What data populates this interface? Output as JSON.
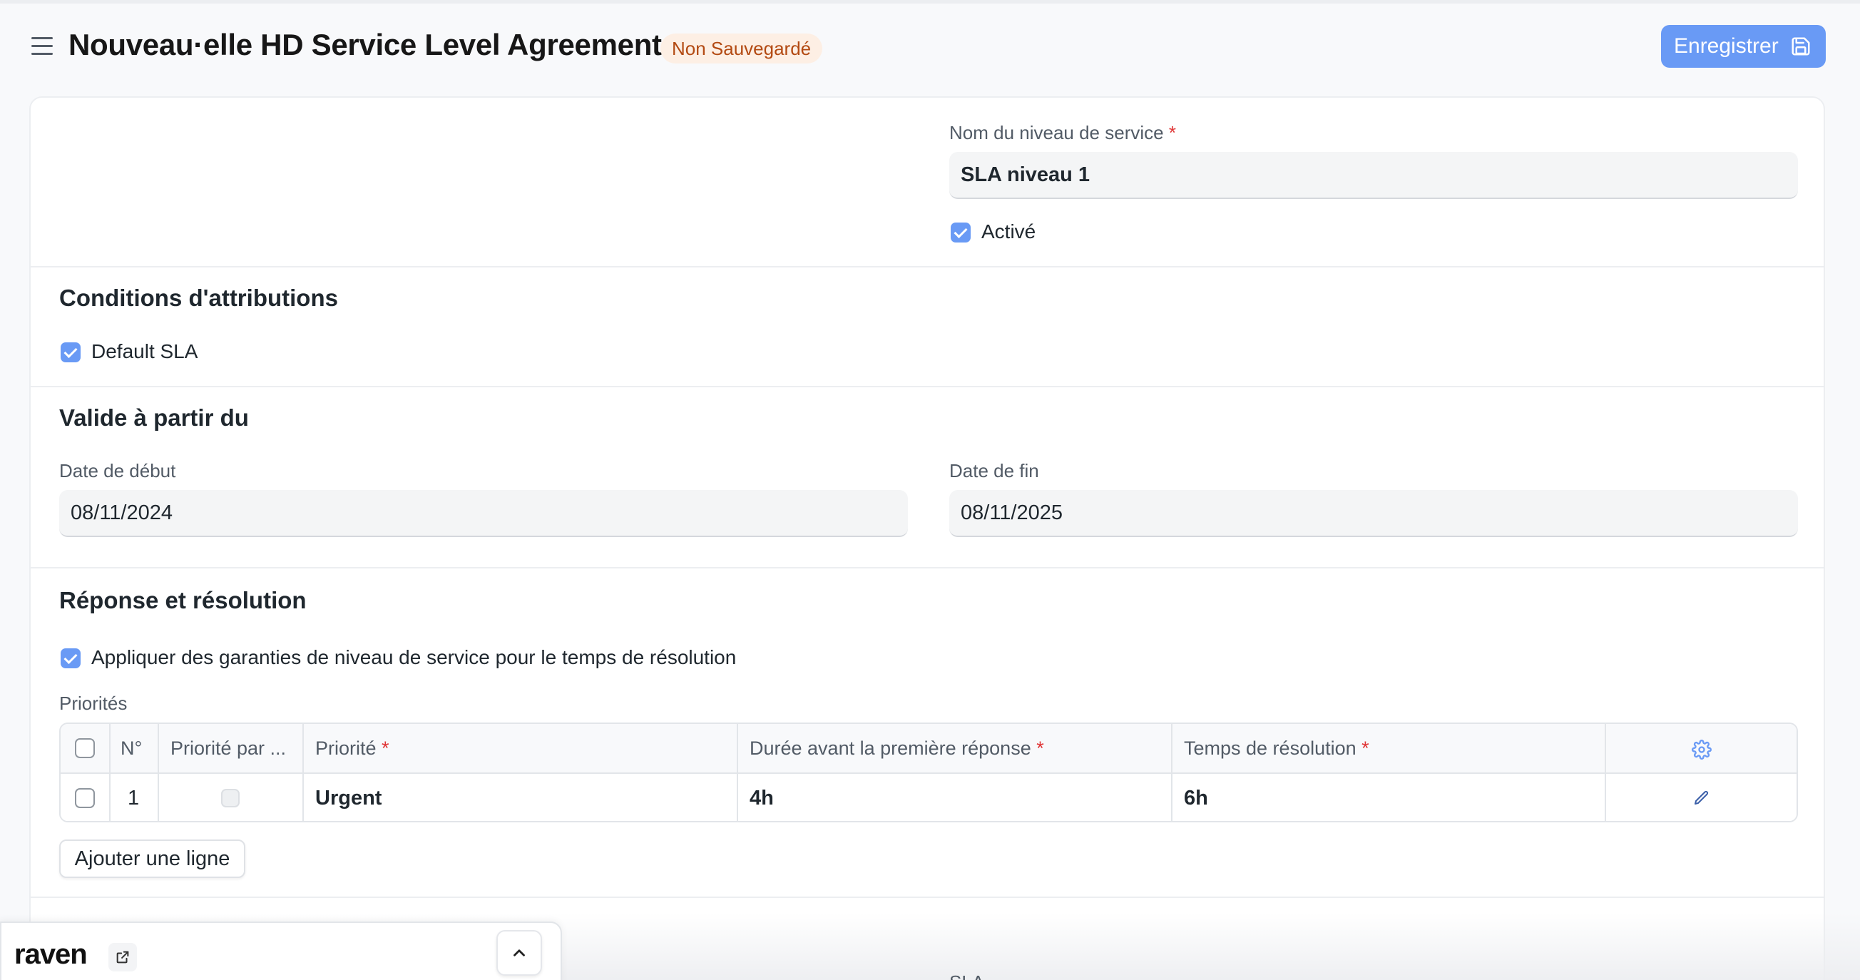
{
  "header": {
    "title": "Nouveau·elle HD Service Level Agreement",
    "status": "Non Sauvegardé",
    "save_label": "Enregistrer",
    "accent_color": "#699af5"
  },
  "service": {
    "name_label": "Nom du niveau de service",
    "required_mark": "*",
    "name_value": "SLA niveau 1",
    "enabled_label": "Activé",
    "enabled": true
  },
  "conditions": {
    "title": "Conditions d'attributions",
    "default_sla_label": "Default SLA",
    "default_sla": true
  },
  "validity": {
    "title": "Valide à partir du",
    "start_label": "Date de début",
    "start_value": "08/11/2024",
    "end_label": "Date de fin",
    "end_value": "08/11/2025"
  },
  "response": {
    "title": "Réponse et résolution",
    "apply_label": "Appliquer des garanties de niveau de service pour le temps de résolution",
    "apply": true,
    "priorities_label": "Priorités",
    "columns": {
      "no": "N°",
      "default_priority": "Priorité par ...",
      "priority": "Priorité",
      "first_response": "Durée avant la première réponse",
      "resolution": "Temps de résolution"
    },
    "rows": [
      {
        "no": "1",
        "default_priority": false,
        "priority": "Urgent",
        "first_response": "4h",
        "resolution": "6h"
      }
    ],
    "add_row_label": "Ajouter une ligne"
  },
  "footer_peek": "SLA",
  "raven": {
    "logo": "raven"
  }
}
